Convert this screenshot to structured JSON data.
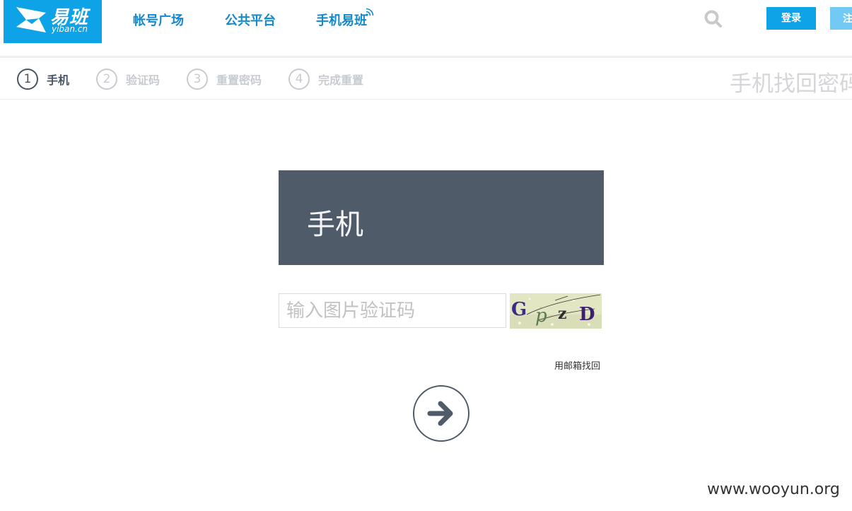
{
  "header": {
    "logo": {
      "name_cn": "易班",
      "name_en": "yiban.cn",
      "brand_color": "#0ea2e6"
    },
    "nav": [
      {
        "label": "帐号广场"
      },
      {
        "label": "公共平台"
      },
      {
        "label": "手机易班"
      }
    ],
    "search_icon": "search-icon",
    "login_label": "登录",
    "register_label": "注"
  },
  "steps": [
    {
      "number": "1",
      "label": "手机",
      "active": true
    },
    {
      "number": "2",
      "label": "验证码",
      "active": false
    },
    {
      "number": "3",
      "label": "重置密码",
      "active": false
    },
    {
      "number": "4",
      "label": "完成重置",
      "active": false
    }
  ],
  "page_heading": "手机找回密码",
  "card": {
    "title": "手机",
    "captcha_placeholder": "输入图片验证码",
    "captcha_text": "GpZD",
    "email_link": "用邮箱找回",
    "next_icon": "arrow-right-icon"
  },
  "watermark": "www.wooyun.org",
  "colors": {
    "accent": "#0ea2e6",
    "nav_text": "#1289cf",
    "card_header": "#4f5b69",
    "step_active": "#4a5563",
    "step_inactive": "#c8ccd0"
  }
}
